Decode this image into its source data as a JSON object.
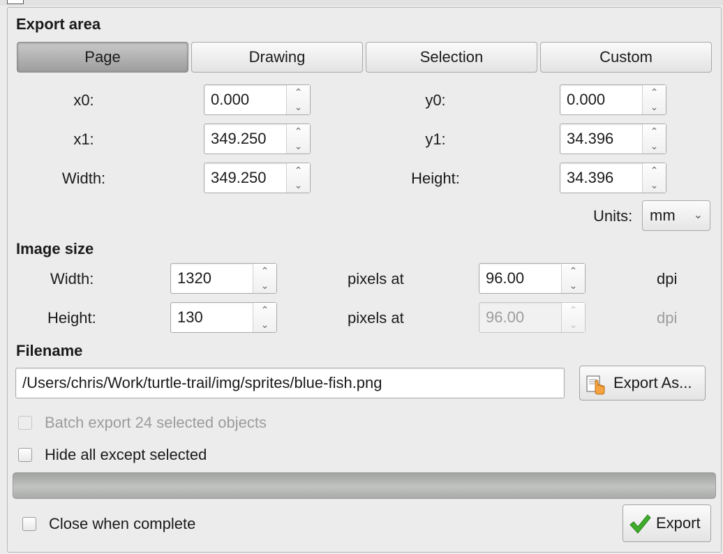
{
  "export_area": {
    "title": "Export area",
    "modes": [
      "Page",
      "Drawing",
      "Selection",
      "Custom"
    ],
    "active_mode": "Page",
    "x0": {
      "label": "x0:",
      "value": "0.000"
    },
    "y0": {
      "label": "y0:",
      "value": "0.000"
    },
    "x1": {
      "label": "x1:",
      "value": "349.250"
    },
    "y1": {
      "label": "y1:",
      "value": "34.396"
    },
    "width": {
      "label": "Width:",
      "value": "349.250"
    },
    "height": {
      "label": "Height:",
      "value": "34.396"
    },
    "units_label": "Units:",
    "units_value": "mm"
  },
  "image_size": {
    "title": "Image size",
    "width_label": "Width:",
    "width_value": "1320",
    "height_label": "Height:",
    "height_value": "130",
    "pixels_at": "pixels at",
    "dpi_x": "96.00",
    "dpi_y": "96.00",
    "dpi_unit": "dpi"
  },
  "filename": {
    "title": "Filename",
    "path": "/Users/chris/Work/turtle-trail/img/sprites/blue-fish.png",
    "export_as_label": "Export As..."
  },
  "options": {
    "batch_export": "Batch export 24 selected objects",
    "hide_all": "Hide all except selected",
    "close_when_complete": "Close when complete"
  },
  "progress": {
    "fraction": 0
  },
  "export_label": "Export",
  "icons": {
    "spin_up": "chevron-up-icon",
    "spin_down": "chevron-down-icon",
    "select_chevron": "chevron-down-icon",
    "export_as": "document-hand-icon",
    "export": "checkmark-icon"
  },
  "colors": {
    "checkmark": "#3fae2a",
    "hand": "#e88a1a"
  }
}
